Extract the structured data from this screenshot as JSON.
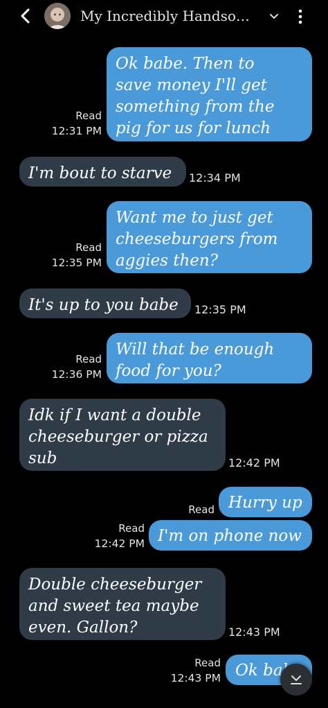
{
  "header": {
    "contact_name": "My Incredibly Handso…"
  },
  "messages": [
    {
      "direction": "sent",
      "text": "Ok babe. Then to\nsave money I'll get\nsomething from the\npig for us for lunch",
      "status": "Read",
      "time": "12:31 PM"
    },
    {
      "direction": "received",
      "text": "I'm bout to starve",
      "time": "12:34 PM"
    },
    {
      "direction": "sent",
      "text": "Want me to just get\ncheeseburgers from\naggies then?",
      "status": "Read",
      "time": "12:35 PM"
    },
    {
      "direction": "received",
      "text": "It's up to you babe",
      "time": "12:35 PM"
    },
    {
      "direction": "sent",
      "text": "Will that be enough\nfood for you?",
      "status": "Read",
      "time": "12:36 PM"
    },
    {
      "direction": "received",
      "text": "Idk if I want a double\ncheeseburger or pizza\nsub",
      "time": "12:42 PM"
    },
    {
      "direction": "sent",
      "text": "Hurry up",
      "status": "Read"
    },
    {
      "direction": "sent",
      "text": "I'm on phone now",
      "status": "Read",
      "time": "12:42 PM"
    },
    {
      "direction": "received",
      "text": "Double cheeseburger\nand sweet tea maybe\neven. Gallon?",
      "time": "12:43 PM"
    },
    {
      "direction": "sent",
      "text": "Ok babe",
      "status": "Read",
      "time": "12:43 PM"
    }
  ],
  "colors": {
    "background": "#000000",
    "sent_bubble": "#4a9ada",
    "received_bubble": "#2f3b47",
    "text": "#ffffff"
  },
  "icons": {
    "back": "back-arrow-icon",
    "chevron": "chevron-down-icon",
    "more": "more-vertical-icon",
    "scroll": "scroll-down-icon"
  }
}
